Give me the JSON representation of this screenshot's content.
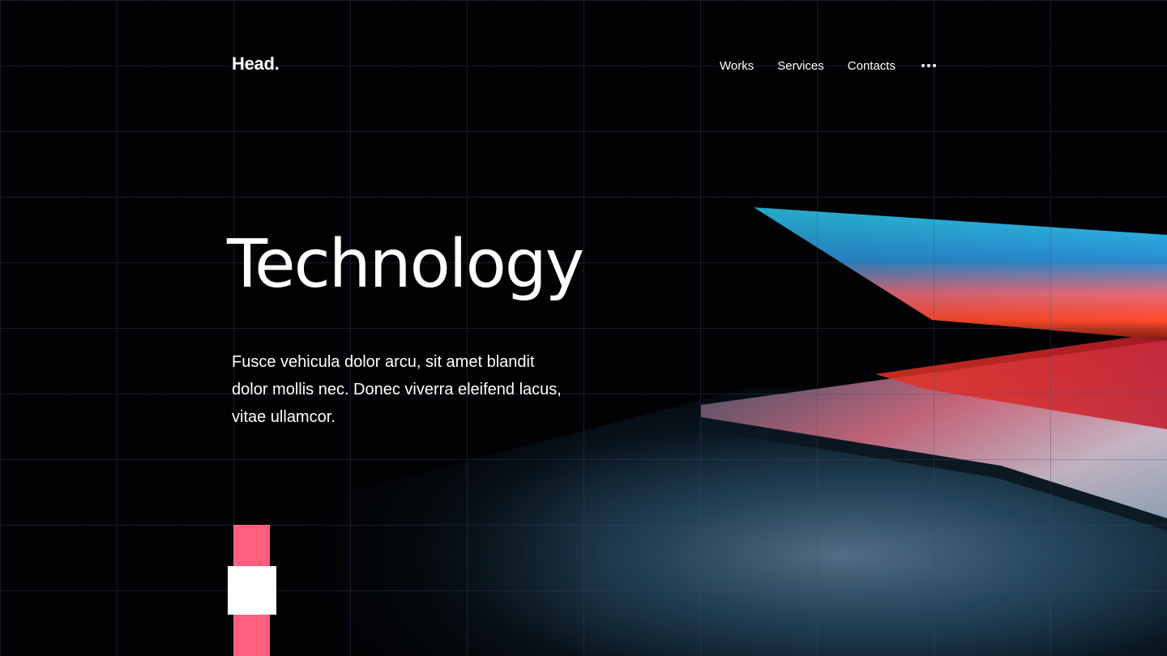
{
  "header": {
    "logo": "Head",
    "logo_dot": "."
  },
  "nav": {
    "items": [
      {
        "label": "Works"
      },
      {
        "label": "Services"
      },
      {
        "label": "Contacts"
      }
    ],
    "more_icon": "more-dots-icon"
  },
  "hero": {
    "title": "Technology",
    "text": "Fusce vehicula dolor arcu, sit amet blandit dolor mollis nec. Donec viverra eleifend lacus, vitae ullamcor."
  },
  "colors": {
    "background": "#020204",
    "accent": "#ff5f7e",
    "text": "#ffffff",
    "grid": "#2a2a4a"
  }
}
